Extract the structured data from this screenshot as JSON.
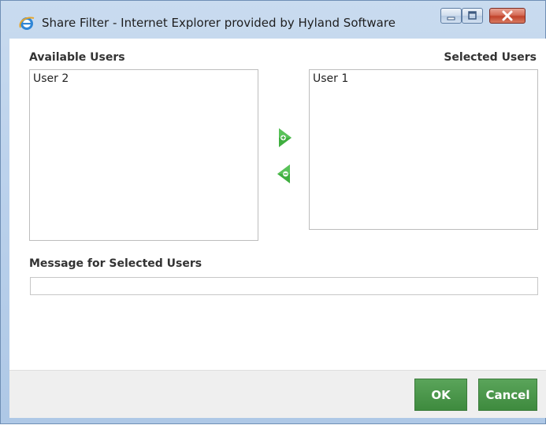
{
  "window": {
    "title": "Share Filter - Internet Explorer provided by Hyland Software",
    "controls": {
      "minimize_icon": "minimize-icon",
      "maximize_icon": "maximize-icon",
      "close_icon": "close-icon"
    }
  },
  "available": {
    "label": "Available Users",
    "items": [
      "User 2"
    ]
  },
  "selected": {
    "label": "Selected Users",
    "items": [
      "User 1"
    ]
  },
  "transfer": {
    "add_icon": "add-arrow-icon",
    "remove_icon": "remove-arrow-icon"
  },
  "message": {
    "label": "Message for Selected Users",
    "value": "",
    "placeholder": ""
  },
  "footer": {
    "ok_label": "OK",
    "cancel_label": "Cancel"
  },
  "colors": {
    "accent_green": "#3e8a3e",
    "arrow_green": "#3fae3f",
    "close_red": "#c1432b"
  }
}
